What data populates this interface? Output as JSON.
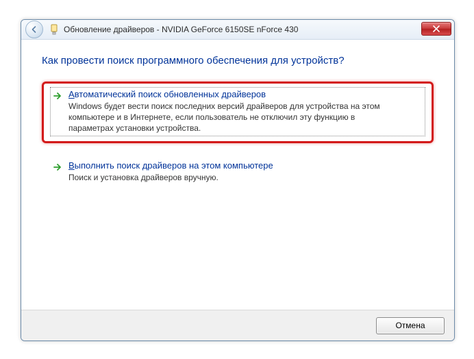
{
  "titlebar": {
    "title": "Обновление драйверов - NVIDIA GeForce 6150SE nForce 430"
  },
  "heading": "Как провести поиск программного обеспечения для устройств?",
  "options": [
    {
      "title_underline_char": "А",
      "title_rest": "втоматический поиск обновленных драйверов",
      "desc": "Windows будет вести поиск последних версий драйверов для устройства на этом компьютере и в Интернете, если пользователь не отключил эту функцию в параметрах установки устройства."
    },
    {
      "title_underline_char": "В",
      "title_rest": "ыполнить поиск драйверов на этом компьютере",
      "desc": "Поиск и установка драйверов вручную."
    }
  ],
  "footer": {
    "cancel": "Отмена"
  }
}
